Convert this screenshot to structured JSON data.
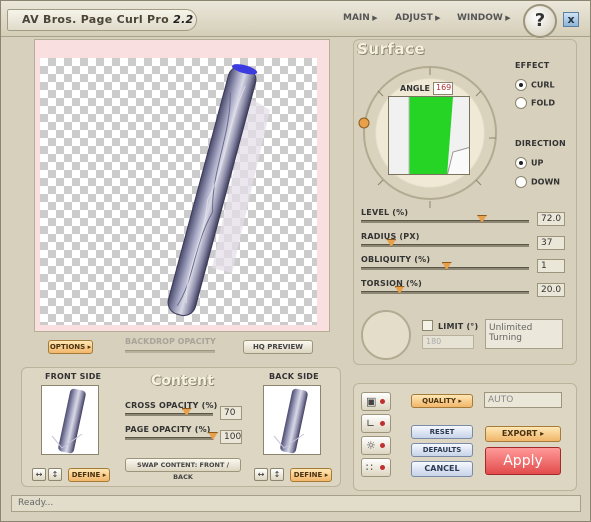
{
  "app": {
    "title": "AV Bros. Page Curl Pro",
    "version": "2.2",
    "menus": [
      "MAIN",
      "ADJUST",
      "WINDOW"
    ],
    "help_label": "?",
    "close_label": "x"
  },
  "preview": {
    "options_label": "OPTIONS",
    "backdrop_label": "BACKDROP OPACITY",
    "hq_label": "HQ PREVIEW"
  },
  "surface": {
    "title": "Surface",
    "angle_label": "ANGLE",
    "angle_value": "169",
    "effect_label": "EFFECT",
    "effect_options": [
      "CURL",
      "FOLD"
    ],
    "effect_selected": "CURL",
    "direction_label": "DIRECTION",
    "direction_options": [
      "UP",
      "DOWN"
    ],
    "direction_selected": "UP",
    "sliders": [
      {
        "label": "LEVEL (%)",
        "value": "72.0",
        "level": 0.72
      },
      {
        "label": "RADIUS (PX)",
        "value": "37",
        "level": 0.18
      },
      {
        "label": "OBLIQUITY (%)",
        "value": "1",
        "level": 0.51
      },
      {
        "label": "TORSION (%)",
        "value": "20.0",
        "level": 0.23
      }
    ],
    "limit_label": "LIMIT (°)",
    "limit_value": "180",
    "limit_text": "Unlimited Turning"
  },
  "content": {
    "title": "Content",
    "front_label": "FRONT SIDE",
    "back_label": "BACK SIDE",
    "define_label": "DEFINE",
    "cross_label": "CROSS OPACITY (%)",
    "cross_value": "70",
    "cross_level": 0.7,
    "page_label": "PAGE OPACITY (%)",
    "page_value": "100",
    "page_level": 1.0,
    "swap_label": "SWAP CONTENT: FRONT / BACK"
  },
  "actions": {
    "quality_label": "QUALITY",
    "quality_value": "AUTO",
    "reset_label": "RESET",
    "defaults_label": "DEFAULTS",
    "cancel_label": "CANCEL",
    "export_label": "EXPORT",
    "apply_label": "Apply"
  },
  "status": {
    "text": "Ready..."
  }
}
